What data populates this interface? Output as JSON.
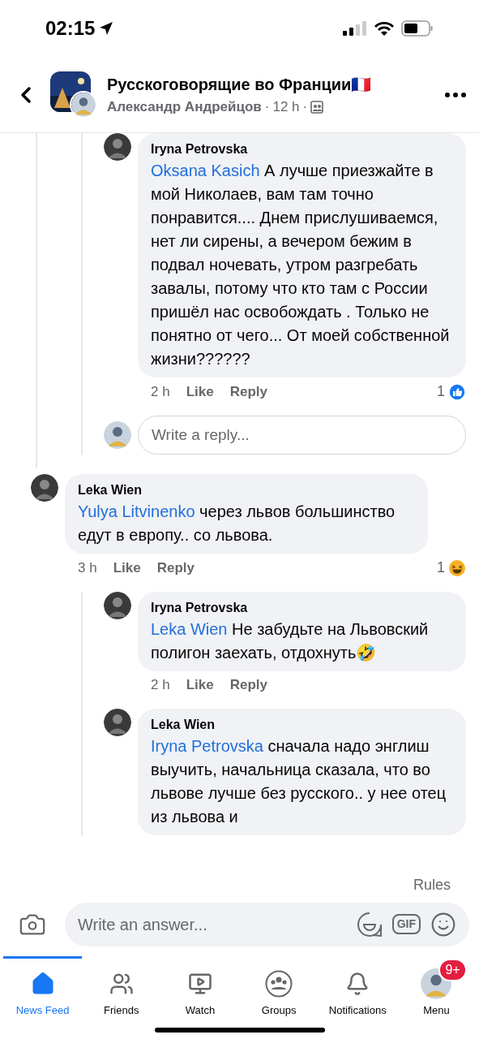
{
  "status_bar": {
    "time": "02:15"
  },
  "header": {
    "title": "Русскоговорящие во Франции🇫🇷",
    "author": "Александр Андрейцов",
    "time": "12 h",
    "separator": "·"
  },
  "thread": [
    {
      "children": [
        {
          "author": "Iryna Petrovska",
          "mention": "Oksana Kasich",
          "text": "А лучше приезжайте в мой Николаев, вам там точно понравится.... Днем прислушиваемся,  нет ли сирены, а вечером бежим в подвал ночевать, утром разгребать завалы, потому что кто  там с России пришёл нас освобождать . Только не понятно от чего... От моей собственной жизни??????",
          "time": "2 h",
          "actions": [
            "Like",
            "Reply"
          ],
          "reaction": {
            "count": "1",
            "kind": "like"
          }
        }
      ],
      "reply_box": {
        "placeholder": "Write a reply..."
      }
    },
    {
      "author": "Leka Wien",
      "mention": "Yulya Litvinenko",
      "text": "через львов большинство едут в европу.. со львова.",
      "time": "3 h",
      "actions": [
        "Like",
        "Reply"
      ],
      "reaction": {
        "count": "1",
        "kind": "haha"
      },
      "children": [
        {
          "author": "Iryna Petrovska",
          "mention": "Leka Wien",
          "text": "Не забудьте на Львовский полигон заехать, отдохнуть🤣",
          "time": "2 h",
          "actions": [
            "Like",
            "Reply"
          ]
        },
        {
          "author": "Leka Wien",
          "mention": "Iryna Petrovska",
          "text": "сначала надо энглиш выучить, начальница сказала, что во львове лучше без русского.. у нее отец из львова и"
        }
      ]
    }
  ],
  "composer": {
    "rules": "Rules",
    "placeholder": "Write an answer...",
    "gif": "GIF"
  },
  "tabs": [
    {
      "label": "News Feed",
      "selected": true
    },
    {
      "label": "Friends",
      "selected": false
    },
    {
      "label": "Watch",
      "selected": false
    },
    {
      "label": "Groups",
      "selected": false
    },
    {
      "label": "Notifications",
      "selected": false
    },
    {
      "label": "Menu",
      "selected": false,
      "badge": "9+"
    }
  ]
}
